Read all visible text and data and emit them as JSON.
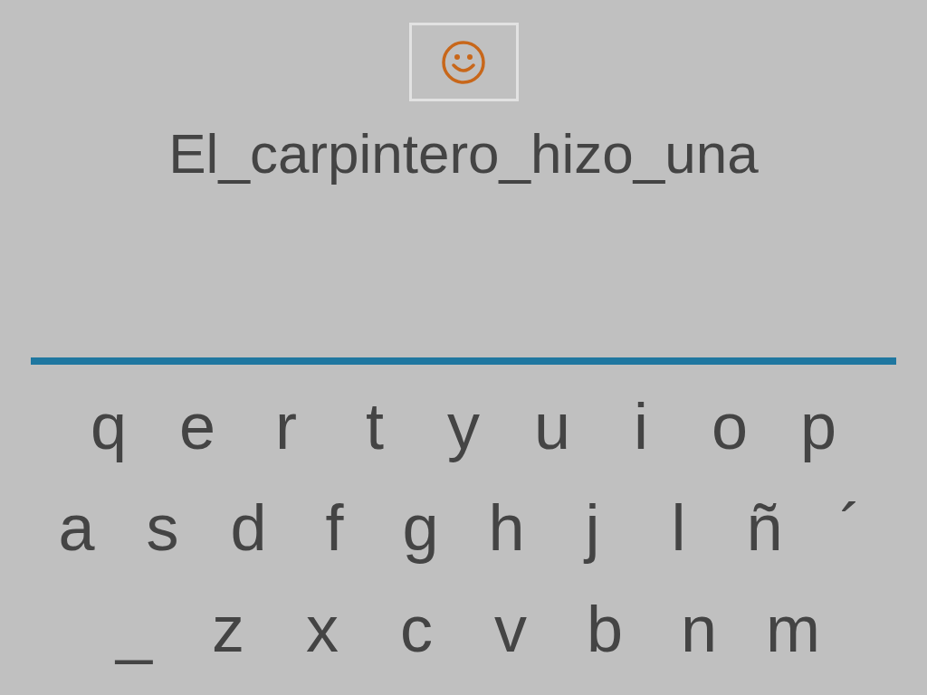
{
  "sentence": "El_carpintero_hizo_una",
  "keyboard": [
    [
      "q",
      "e",
      "r",
      "t",
      "y",
      "u",
      "i",
      "o",
      "p"
    ],
    [
      "a",
      "s",
      "d",
      "f",
      "g",
      "h",
      "j",
      "l",
      "ñ",
      "´"
    ],
    [
      "_",
      "z",
      "x",
      "c",
      "v",
      "b",
      "n",
      "m"
    ]
  ]
}
